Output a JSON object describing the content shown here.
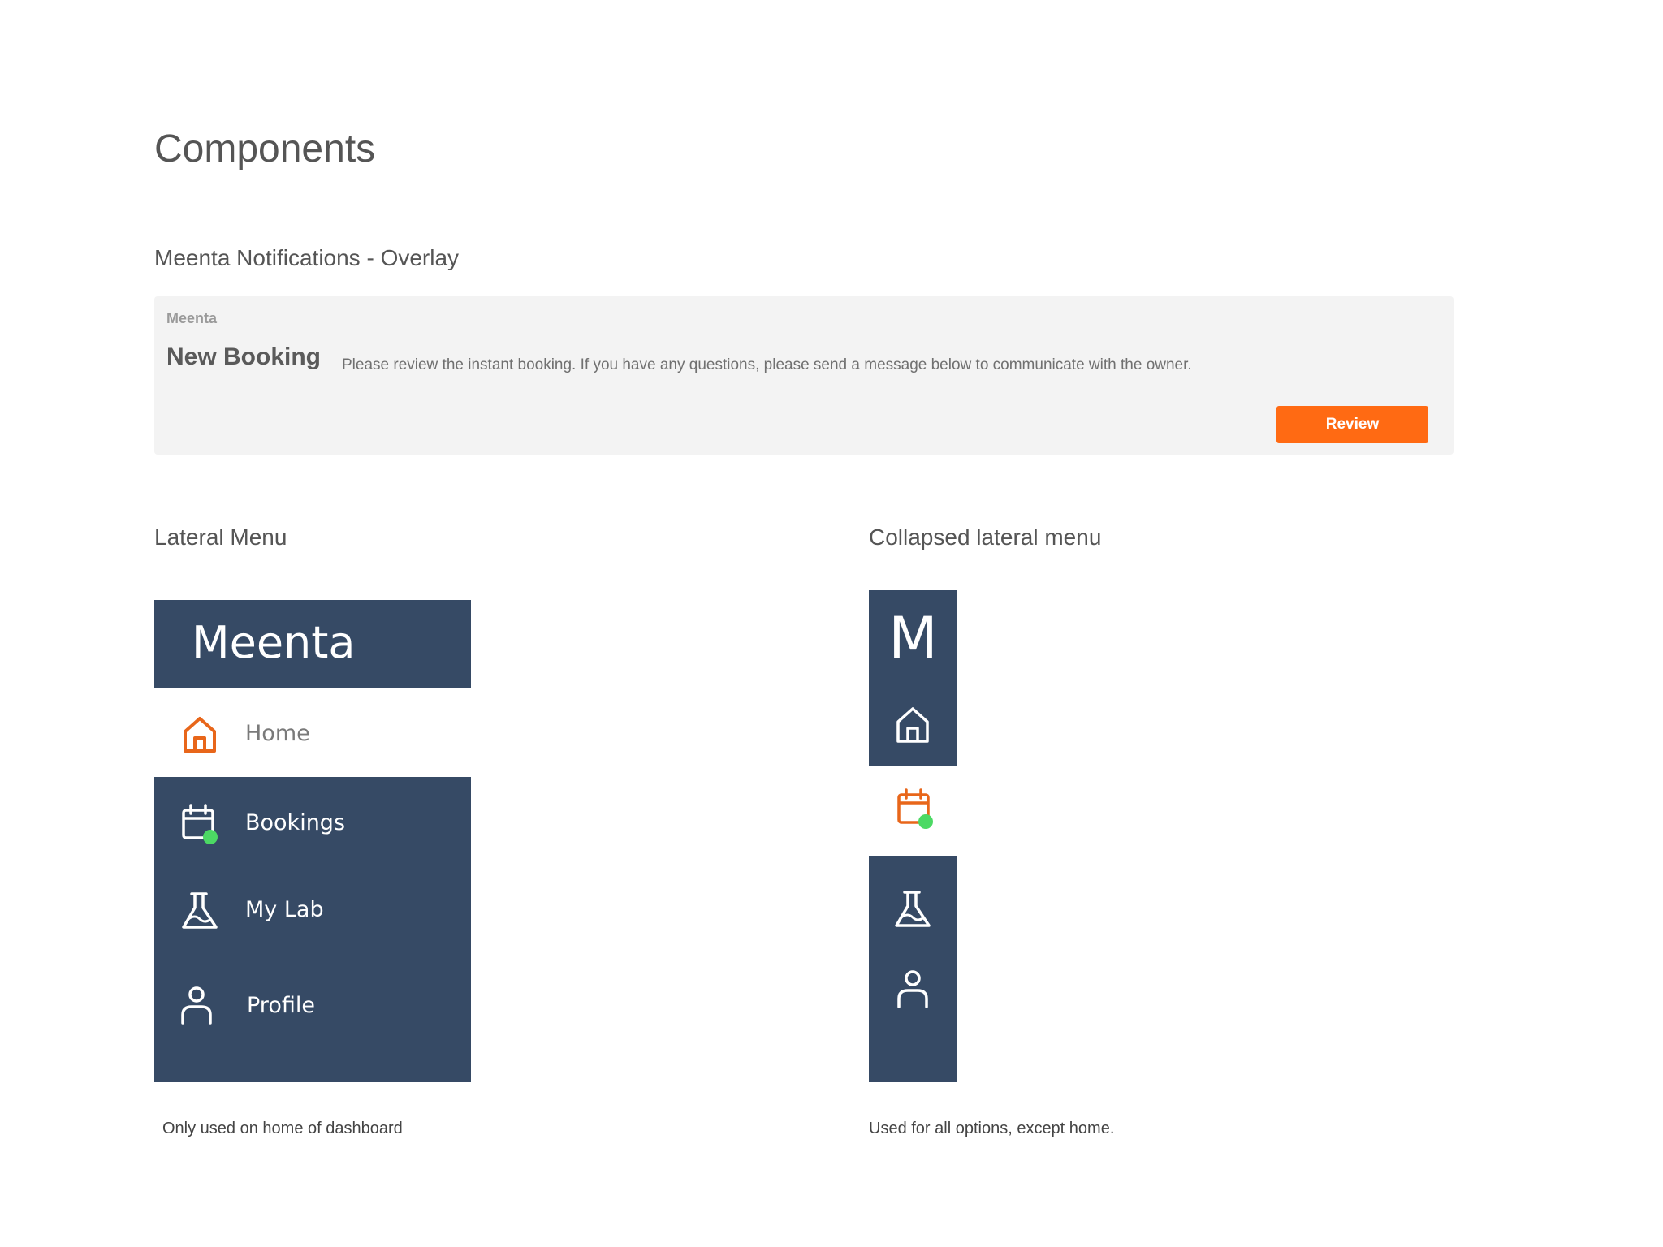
{
  "page": {
    "title": "Components"
  },
  "notifications_section": {
    "title": "Meenta Notifications - Overlay",
    "notification": {
      "app_name": "Meenta",
      "title": "New Booking",
      "message": "Please review the instant booking. If you have any questions, please send a message below to communicate with the owner.",
      "action_label": "Review"
    }
  },
  "lateral_menu": {
    "title": "Lateral Menu",
    "brand": "Meenta",
    "items": [
      {
        "label": "Home",
        "icon": "home-icon",
        "active": true
      },
      {
        "label": "Bookings",
        "icon": "calendar-icon",
        "badge": true
      },
      {
        "label": "My Lab",
        "icon": "flask-icon"
      },
      {
        "label": "Profile",
        "icon": "user-icon"
      }
    ],
    "caption": "Only used on home of dashboard"
  },
  "collapsed_menu": {
    "title": "Collapsed lateral menu",
    "brand_letter": "M",
    "items": [
      {
        "icon": "home-icon"
      },
      {
        "icon": "calendar-icon",
        "active": true,
        "badge": true
      },
      {
        "icon": "flask-icon"
      },
      {
        "icon": "user-icon"
      }
    ],
    "caption": "Used for all options, except home."
  },
  "colors": {
    "menu_bg": "#364a65",
    "accent": "#ff6a13",
    "icon_active": "#e8661a",
    "badge": "#4cd964",
    "notification_bg": "#f3f3f3"
  }
}
